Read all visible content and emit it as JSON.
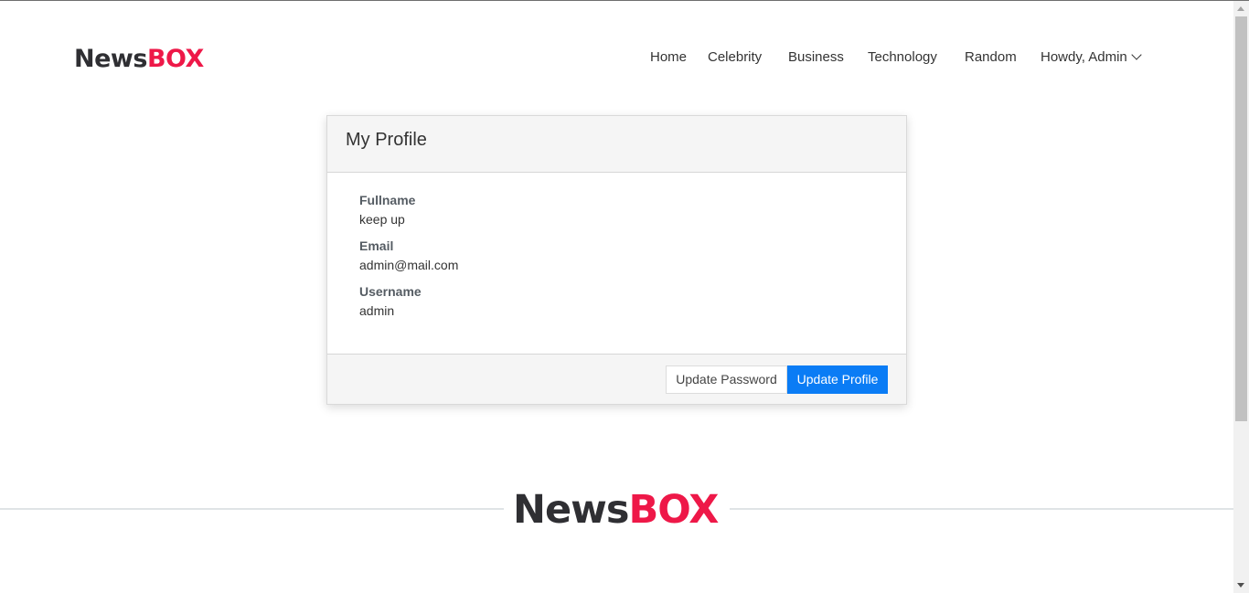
{
  "header": {
    "logo": {
      "part1": "News",
      "part2": "BOX"
    },
    "nav": [
      {
        "label": "Home"
      },
      {
        "label": "Celebrity"
      },
      {
        "label": "Business"
      },
      {
        "label": "Technology"
      },
      {
        "label": "Random"
      }
    ],
    "user_menu": {
      "label": "Howdy, Admin",
      "icon": "chevron-down-icon"
    }
  },
  "profile_card": {
    "title": "My Profile",
    "fields": [
      {
        "label": "Fullname",
        "value": "keep up"
      },
      {
        "label": "Email",
        "value": "admin@mail.com"
      },
      {
        "label": "Username",
        "value": "admin"
      }
    ],
    "buttons": {
      "update_password": "Update Password",
      "update_profile": "Update Profile"
    }
  },
  "footer": {
    "logo": {
      "part1": "News",
      "part2": "BOX"
    }
  },
  "colors": {
    "brand_dark": "#2f2f33",
    "brand_accent": "#ee1848",
    "primary_button": "#0a7cf5"
  }
}
